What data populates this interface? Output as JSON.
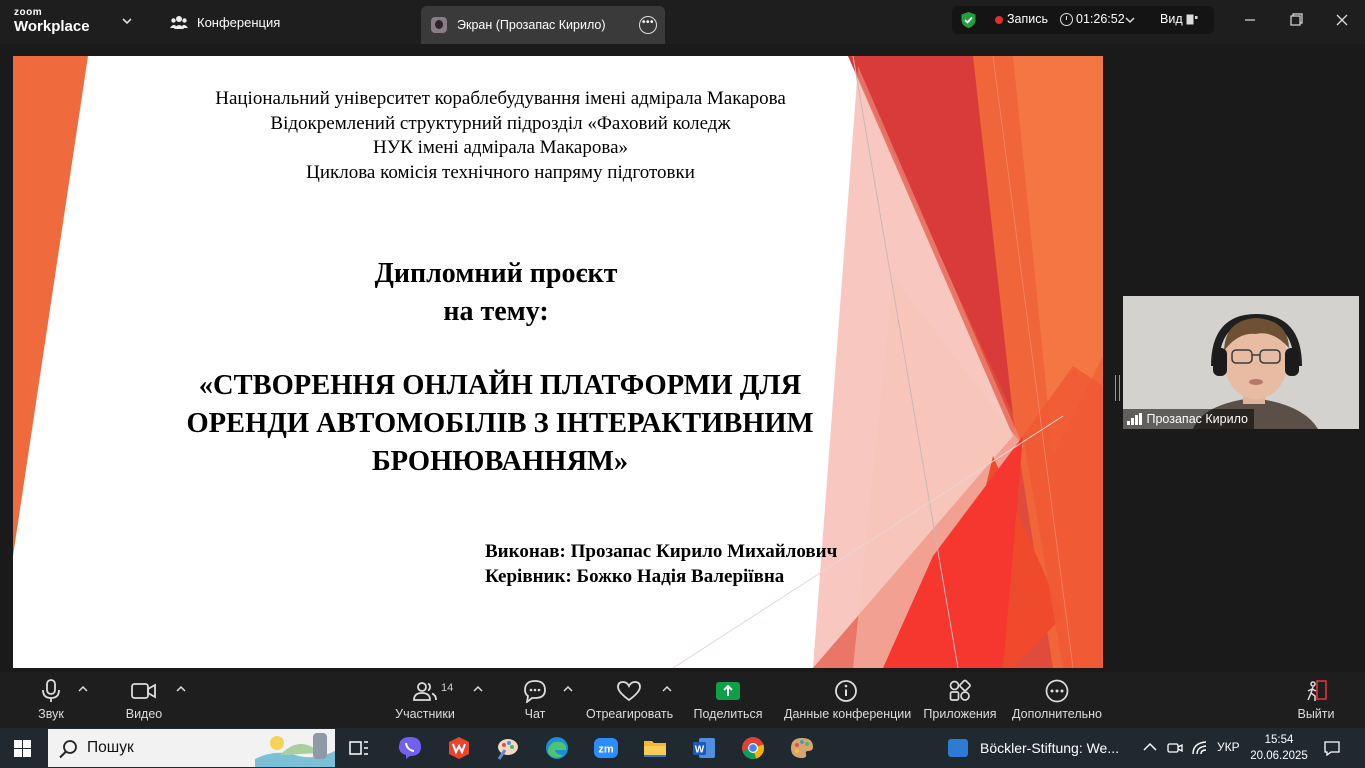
{
  "app": {
    "logo_top": "zoom",
    "logo_bottom": "Workplace",
    "conference_tab": "Конференция",
    "screen_tab": "Экран (Прозапас Кирило)",
    "record_label": "Запись",
    "timer": "01:26:52",
    "view_label": "Вид"
  },
  "slide": {
    "institution_lines": [
      "Національний університет кораблебудування  імені адмірала Макарова",
      "Відокремлений структурний підрозділ «Фаховий коледж",
      "НУК імені адмірала Макарова»",
      "Циклова комісія  технічного напряму підготовки"
    ],
    "diploma_lines": [
      "Дипломний проєкт",
      "на тему:"
    ],
    "project_lines": [
      "«СТВОРЕННЯ ОНЛАЙН ПЛАТФОРМИ ДЛЯ",
      "ОРЕНДИ АВТОМОБІЛІВ З ІНТЕРАКТИВНИМ",
      "БРОНЮВАННЯМ»"
    ],
    "author": "Виконав: Прозапас Кирило Михайлович",
    "supervisor": "Керівник: Божко Надія Валеріївна"
  },
  "camera": {
    "participant_name": "Прозапас Кирило"
  },
  "toolbar": {
    "audio": "Звук",
    "video": "Видео",
    "participants": "Участники",
    "participants_count": "14",
    "chat": "Чат",
    "react": "Отреагировать",
    "share": "Поделиться",
    "conference_data": "Данные конференции",
    "apps": "Приложения",
    "more": "Дополнительно",
    "leave": "Выйти"
  },
  "taskbar": {
    "search_placeholder": "Пошук",
    "notification": "Böckler-Stiftung: We...",
    "language": "УКР",
    "time": "15:54",
    "date": "20.06.2025",
    "pinned_icons": [
      "task-view-icon",
      "viber-icon",
      "wps-office-icon",
      "paint-icon",
      "edge-icon",
      "zoom-app-icon",
      "file-explorer-icon",
      "word-icon",
      "chrome-icon",
      "paint-palette-icon"
    ]
  },
  "colors": {
    "zoom_share_green": "#0e9f4a",
    "record_red": "#e0302b",
    "slide_red": "#e53935",
    "slide_orange": "#f0653a"
  }
}
